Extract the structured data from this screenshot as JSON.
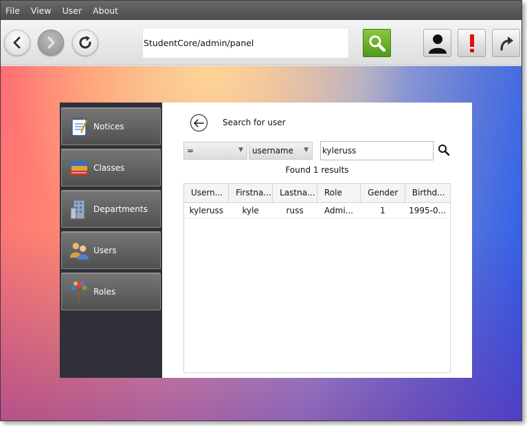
{
  "menu": [
    "File",
    "View",
    "User",
    "About"
  ],
  "toolbar": {
    "address": "StudentCore/admin/panel"
  },
  "sidebar": {
    "items": [
      {
        "label": "Notices",
        "icon": "notepad-icon"
      },
      {
        "label": "Classes",
        "icon": "books-icon"
      },
      {
        "label": "Departments",
        "icon": "building-icon"
      },
      {
        "label": "Users",
        "icon": "users-icon"
      },
      {
        "label": "Roles",
        "icon": "role-tree-icon"
      }
    ]
  },
  "search": {
    "title": "Search for user",
    "operator": "=",
    "field": "username",
    "query": "kyleruss",
    "result_text": "Found 1 results"
  },
  "table": {
    "columns": [
      "Usern...",
      "Firstna...",
      "Lastna...",
      "Role",
      "Gender",
      "Birthd..."
    ],
    "rows": [
      [
        "kyleruss",
        "kyle",
        "russ",
        "Admi...",
        "1",
        "1995-0..."
      ]
    ]
  },
  "colors": {
    "go_button": "#6bb12e",
    "alert_red": "#e01010",
    "sidebar_bg": "#2f3039"
  }
}
